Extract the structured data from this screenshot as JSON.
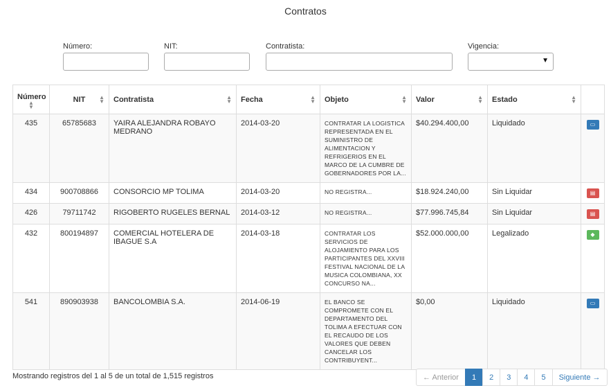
{
  "page": {
    "title": "Contratos"
  },
  "filters": {
    "numero_label": "Número:",
    "nit_label": "NIT:",
    "contratista_label": "Contratista:",
    "vigencia_label": "Vigencia:",
    "vigencia_value": ""
  },
  "table": {
    "headers": [
      "Número",
      "NIT",
      "Contratista",
      "Fecha",
      "Objeto",
      "Valor",
      "Estado"
    ],
    "rows": [
      {
        "numero": "435",
        "nit": "65785683",
        "contratista": "YAIRA ALEJANDRA ROBAYO MEDRANO",
        "fecha": "2014-03-20",
        "objeto": "CONTRATAR LA LOGISTICA REPRESENTADA EN EL SUMINISTRO DE ALIMENTACION Y REFRIGERIOS EN EL MARCO DE LA CUMBRE DE GOBERNADORES POR LA...",
        "valor": "$40.294.400,00",
        "estado": "Liquidado",
        "action_icon": "money-icon",
        "action_color": "#337ab7"
      },
      {
        "numero": "434",
        "nit": "900708866",
        "contratista": "CONSORCIO MP TOLIMA",
        "fecha": "2014-03-20",
        "objeto": "NO REGISTRA...",
        "valor": "$18.924.240,00",
        "estado": "Sin Liquidar",
        "action_icon": "pdf-icon",
        "action_color": "#d9534f"
      },
      {
        "numero": "426",
        "nit": "79711742",
        "contratista": "RIGOBERTO RUGELES BERNAL",
        "fecha": "2014-03-12",
        "objeto": "NO REGISTRA...",
        "valor": "$77.996.745,84",
        "estado": "Sin Liquidar",
        "action_icon": "pdf-icon",
        "action_color": "#d9534f"
      },
      {
        "numero": "432",
        "nit": "800194897",
        "contratista": "COMERCIAL HOTELERA DE IBAGUE S.A",
        "fecha": "2014-03-18",
        "objeto": "CONTRATAR LOS SERVICIOS DE ALOJAMIENTO PARA LOS PARTICIPANTES DEL XXVIII FESTIVAL NACIONAL DE LA MUSICA COLOMBIANA, XX CONCURSO NA...",
        "valor": "$52.000.000,00",
        "estado": "Legalizado",
        "action_icon": "tags-icon",
        "action_color": "#5cb85c"
      },
      {
        "numero": "541",
        "nit": "890903938",
        "contratista": "BANCOLOMBIA S.A.",
        "fecha": "2014-06-19",
        "objeto": "EL BANCO SE COMPROMETE CON EL DEPARTAMENTO DEL TOLIMA A EFECTUAR CON EL RECAUDO DE LOS VALORES QUE DEBEN CANCELAR LOS CONTRIBUYENT...",
        "valor": "$0,00",
        "estado": "Liquidado",
        "action_icon": "money-icon",
        "action_color": "#337ab7"
      }
    ]
  },
  "footer": {
    "info": "Mostrando registros del 1 al 5 de un total de 1,515 registros",
    "prev": "← Anterior",
    "pages": [
      "1",
      "2",
      "3",
      "4",
      "5"
    ],
    "active_page": "1",
    "next": "Siguiente →"
  }
}
